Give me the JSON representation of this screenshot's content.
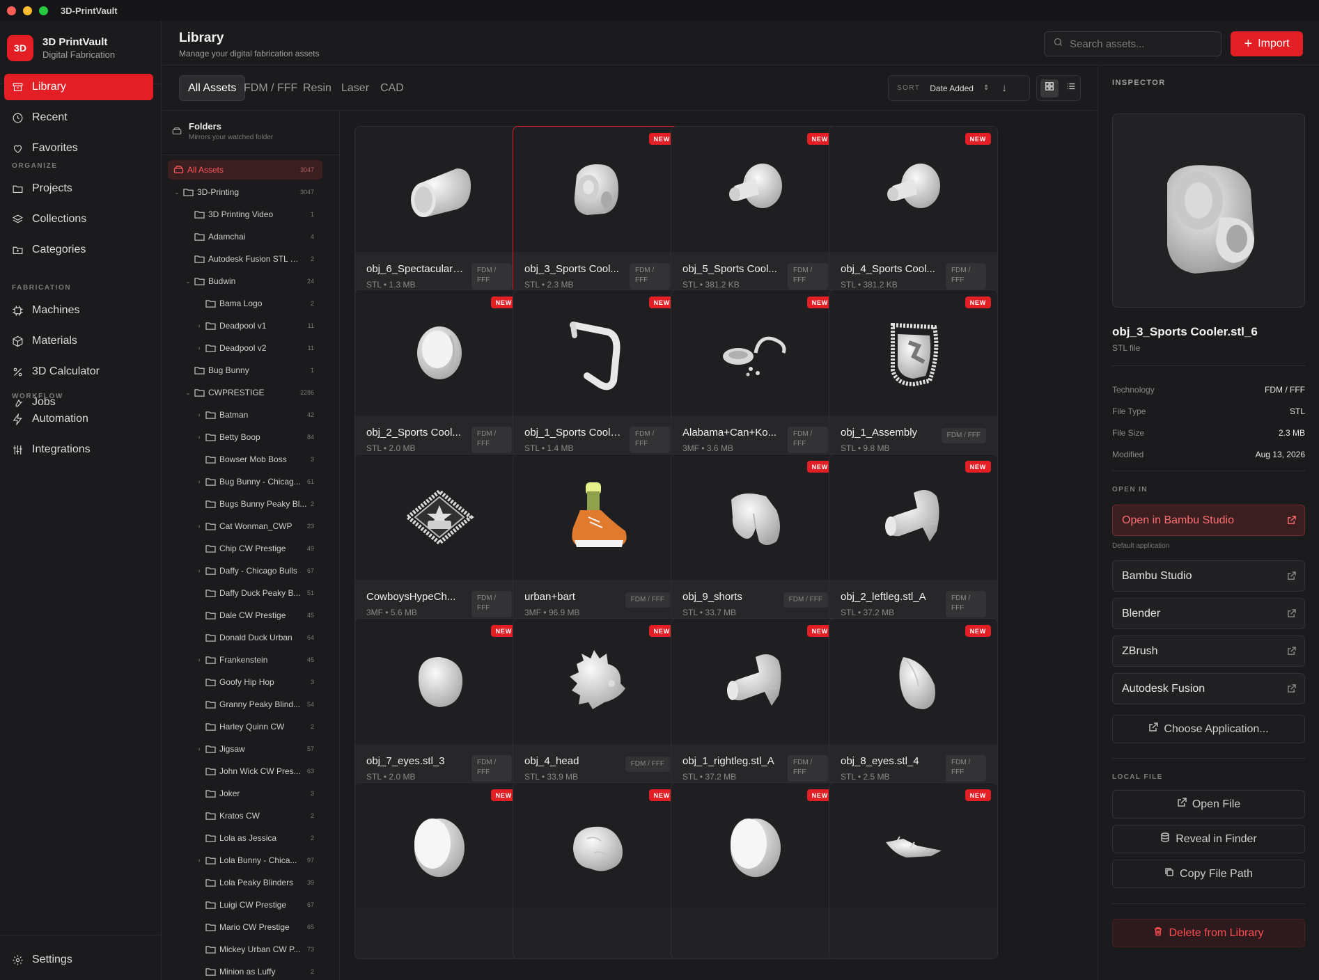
{
  "window": {
    "title": "3D-PrintVault"
  },
  "brand": {
    "logo": "3D",
    "name": "3D PrintVault",
    "subtitle": "Digital Fabrication"
  },
  "nav": {
    "main": [
      {
        "label": "Library",
        "icon": "archive-icon"
      },
      {
        "label": "Recent",
        "icon": "clock-icon"
      },
      {
        "label": "Favorites",
        "icon": "heart-icon"
      }
    ],
    "organize_header": "ORGANIZE",
    "organize": [
      {
        "label": "Projects",
        "icon": "folder-icon"
      },
      {
        "label": "Collections",
        "icon": "layers-icon"
      },
      {
        "label": "Categories",
        "icon": "tag-folder-icon"
      }
    ],
    "fabrication_header": "FABRICATION",
    "fabrication": [
      {
        "label": "Machines",
        "icon": "cpu-icon"
      },
      {
        "label": "Materials",
        "icon": "box-icon"
      },
      {
        "label": "3D Calculator",
        "icon": "percent-icon"
      },
      {
        "label": "Jobs",
        "icon": "wrench-icon"
      }
    ],
    "workflow_header": "WORKFLOW",
    "workflow": [
      {
        "label": "Automation",
        "icon": "bolt-icon"
      },
      {
        "label": "Integrations",
        "icon": "sliders-icon"
      }
    ],
    "settings": "Settings"
  },
  "header": {
    "title": "Library",
    "subtitle": "Manage your digital fabrication assets",
    "search_placeholder": "Search assets...",
    "import_label": "Import"
  },
  "toolbar": {
    "tabs": [
      "All Assets",
      "FDM / FFF",
      "Resin",
      "Laser",
      "CAD"
    ],
    "sort_label": "SORT",
    "sort_value": "Date Added"
  },
  "folders": {
    "title": "Folders",
    "subtitle": "Mirrors your watched folder",
    "items": [
      {
        "name": "All Assets",
        "count": "3047",
        "depth": 0,
        "chev": "",
        "active": true
      },
      {
        "name": "3D-Printing",
        "count": "3047",
        "depth": 0,
        "chev": "⌄"
      },
      {
        "name": "3D Printing Video",
        "count": "1",
        "depth": 1,
        "chev": ""
      },
      {
        "name": "Adamchai",
        "count": "4",
        "depth": 1,
        "chev": ""
      },
      {
        "name": "Autodesk Fusion STL Fi...",
        "count": "2",
        "depth": 1,
        "chev": ""
      },
      {
        "name": "Budwin",
        "count": "24",
        "depth": 1,
        "chev": "⌄"
      },
      {
        "name": "Bama Logo",
        "count": "2",
        "depth": 2,
        "chev": ""
      },
      {
        "name": "Deadpool v1",
        "count": "11",
        "depth": 2,
        "chev": "›"
      },
      {
        "name": "Deadpool v2",
        "count": "11",
        "depth": 2,
        "chev": "›"
      },
      {
        "name": "Bug Bunny",
        "count": "1",
        "depth": 1,
        "chev": ""
      },
      {
        "name": "CWPRESTIGE",
        "count": "2286",
        "depth": 1,
        "chev": "⌄"
      },
      {
        "name": "Batman",
        "count": "42",
        "depth": 2,
        "chev": "›"
      },
      {
        "name": "Betty Boop",
        "count": "84",
        "depth": 2,
        "chev": "›"
      },
      {
        "name": "Bowser Mob Boss",
        "count": "3",
        "depth": 2,
        "chev": ""
      },
      {
        "name": "Bug Bunny - Chicag...",
        "count": "61",
        "depth": 2,
        "chev": "›"
      },
      {
        "name": "Bugs Bunny Peaky Bl...",
        "count": "2",
        "depth": 2,
        "chev": ""
      },
      {
        "name": "Cat Wonman_CWP",
        "count": "23",
        "depth": 2,
        "chev": "›"
      },
      {
        "name": "Chip CW Prestige",
        "count": "49",
        "depth": 2,
        "chev": ""
      },
      {
        "name": "Daffy - Chicago Bulls",
        "count": "67",
        "depth": 2,
        "chev": "›"
      },
      {
        "name": "Daffy Duck Peaky B...",
        "count": "51",
        "depth": 2,
        "chev": ""
      },
      {
        "name": "Dale CW Prestige",
        "count": "45",
        "depth": 2,
        "chev": ""
      },
      {
        "name": "Donald Duck Urban",
        "count": "64",
        "depth": 2,
        "chev": ""
      },
      {
        "name": "Frankenstein",
        "count": "45",
        "depth": 2,
        "chev": "›"
      },
      {
        "name": "Goofy Hip Hop",
        "count": "3",
        "depth": 2,
        "chev": ""
      },
      {
        "name": "Granny Peaky Blind...",
        "count": "54",
        "depth": 2,
        "chev": ""
      },
      {
        "name": "Harley Quinn CW",
        "count": "2",
        "depth": 2,
        "chev": ""
      },
      {
        "name": "Jigsaw",
        "count": "57",
        "depth": 2,
        "chev": "›"
      },
      {
        "name": "John Wick CW Pres...",
        "count": "63",
        "depth": 2,
        "chev": ""
      },
      {
        "name": "Joker",
        "count": "3",
        "depth": 2,
        "chev": ""
      },
      {
        "name": "Kratos CW",
        "count": "2",
        "depth": 2,
        "chev": ""
      },
      {
        "name": "Lola as Jessica",
        "count": "2",
        "depth": 2,
        "chev": ""
      },
      {
        "name": "Lola Bunny - Chica...",
        "count": "97",
        "depth": 2,
        "chev": "›"
      },
      {
        "name": "Lola Peaky Blinders",
        "count": "39",
        "depth": 2,
        "chev": ""
      },
      {
        "name": "Luigi CW Prestige",
        "count": "67",
        "depth": 2,
        "chev": ""
      },
      {
        "name": "Mario CW Prestige",
        "count": "65",
        "depth": 2,
        "chev": ""
      },
      {
        "name": "Mickey Urban CW P...",
        "count": "73",
        "depth": 2,
        "chev": ""
      },
      {
        "name": "Minion as Luffy",
        "count": "2",
        "depth": 2,
        "chev": ""
      }
    ]
  },
  "assets": [
    {
      "name": "obj_6_Spectacular ...",
      "meta": "STL • 1.3 MB",
      "tag": "FDM / FFF",
      "new": false,
      "shape": "cylinder"
    },
    {
      "name": "obj_3_Sports Cool...",
      "meta": "STL • 2.3 MB",
      "tag": "FDM / FFF",
      "new": true,
      "shape": "cooler",
      "selected": true
    },
    {
      "name": "obj_5_Sports Cool...",
      "meta": "STL • 381.2 KB",
      "tag": "FDM / FFF",
      "new": true,
      "shape": "knob"
    },
    {
      "name": "obj_4_Sports Cool...",
      "meta": "STL • 381.2 KB",
      "tag": "FDM / FFF",
      "new": true,
      "shape": "knob"
    },
    {
      "name": "obj_2_Sports Cool...",
      "meta": "STL • 2.0 MB",
      "tag": "FDM / FFF",
      "new": true,
      "shape": "cap"
    },
    {
      "name": "obj_1_Sports Coole...",
      "meta": "STL • 1.4 MB",
      "tag": "FDM / FFF",
      "new": true,
      "shape": "handle"
    },
    {
      "name": "Alabama+Can+Ko...",
      "meta": "3MF • 3.6 MB",
      "tag": "FDM / FFF",
      "new": true,
      "shape": "parts"
    },
    {
      "name": "obj_1_Assembly",
      "meta": "STL • 9.8 MB",
      "tag": "FDM / FFF",
      "new": true,
      "shape": "badge"
    },
    {
      "name": "CowboysHypeCh...",
      "meta": "3MF • 5.6 MB",
      "tag": "FDM / FFF",
      "new": false,
      "shape": "chain"
    },
    {
      "name": "urban+bart",
      "meta": "3MF • 96.9 MB",
      "tag": "FDM / FFF",
      "new": false,
      "shape": "sneaker"
    },
    {
      "name": "obj_9_shorts",
      "meta": "STL • 33.7 MB",
      "tag": "FDM / FFF",
      "new": true,
      "shape": "shorts"
    },
    {
      "name": "obj_2_leftleg.stl_A",
      "meta": "STL • 37.2 MB",
      "tag": "FDM / FFF",
      "new": true,
      "shape": "leg"
    },
    {
      "name": "obj_7_eyes.stl_3",
      "meta": "STL • 2.0 MB",
      "tag": "FDM / FFF",
      "new": true,
      "shape": "egg"
    },
    {
      "name": "obj_4_head",
      "meta": "STL • 33.9 MB",
      "tag": "FDM / FFF",
      "new": true,
      "shape": "head"
    },
    {
      "name": "obj_1_rightleg.stl_A",
      "meta": "STL • 37.2 MB",
      "tag": "FDM / FFF",
      "new": true,
      "shape": "leg"
    },
    {
      "name": "obj_8_eyes.stl_4",
      "meta": "STL • 2.5 MB",
      "tag": "FDM / FFF",
      "new": true,
      "shape": "egg2"
    },
    {
      "name": "",
      "meta": "",
      "tag": "",
      "new": true,
      "shape": "puck"
    },
    {
      "name": "",
      "meta": "",
      "tag": "",
      "new": true,
      "shape": "blob"
    },
    {
      "name": "",
      "meta": "",
      "tag": "",
      "new": true,
      "shape": "puck"
    },
    {
      "name": "",
      "meta": "",
      "tag": "",
      "new": true,
      "shape": "flat"
    }
  ],
  "new_badge": "NEW",
  "inspector": {
    "header": "INSPECTOR",
    "name": "obj_3_Sports Cooler.stl_6",
    "type": "STL file",
    "props": [
      {
        "k": "Technology",
        "v": "FDM / FFF"
      },
      {
        "k": "File Type",
        "v": "STL"
      },
      {
        "k": "File Size",
        "v": "2.3 MB"
      },
      {
        "k": "Modified",
        "v": "Aug 13, 2026"
      }
    ],
    "open_in_header": "OPEN IN",
    "primary_app": "Open in Bambu Studio",
    "default_note": "Default application",
    "apps": [
      "Bambu Studio",
      "Blender",
      "ZBrush",
      "Autodesk Fusion"
    ],
    "choose_app": "Choose Application...",
    "local_header": "LOCAL FILE",
    "open_file": "Open File",
    "reveal": "Reveal in Finder",
    "copy_path": "Copy File Path",
    "delete": "Delete from Library"
  }
}
